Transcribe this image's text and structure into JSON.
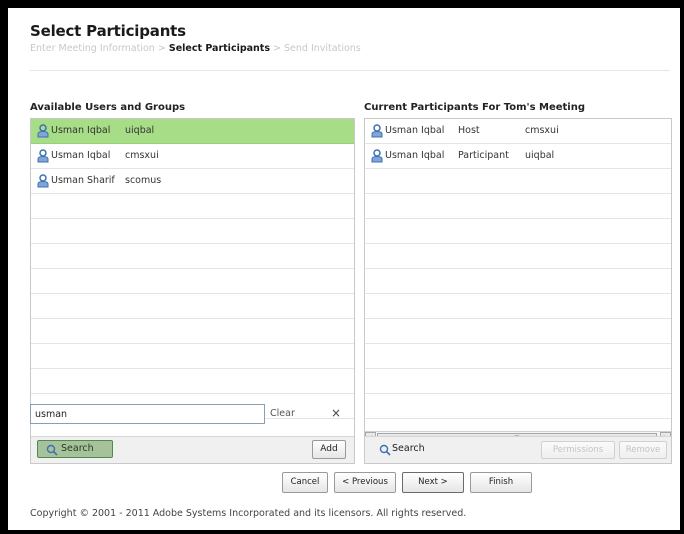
{
  "page": {
    "title": "Select Participants",
    "breadcrumb": {
      "step1": "Enter Meeting Information",
      "sep": ">",
      "step2": "Select Participants",
      "step3": "Send Invitations"
    }
  },
  "available": {
    "title": "Available Users and Groups",
    "rows": [
      {
        "name": "Usman Iqbal",
        "login": "uiqbal"
      },
      {
        "name": "Usman Iqbal",
        "login": "cmsxui"
      },
      {
        "name": "Usman Sharif",
        "login": "scomus"
      }
    ],
    "search_value": "usman",
    "clear_label": "Clear",
    "clear_icon": "×",
    "search_label": "Search",
    "add_label": "Add"
  },
  "current": {
    "title": "Current Participants For Tom's Meeting",
    "rows": [
      {
        "name": "Usman Iqbal",
        "role": "Host",
        "login": "cmsxui"
      },
      {
        "name": "Usman Iqbal",
        "role": "Participant",
        "login": "uiqbal"
      }
    ],
    "search_label": "Search",
    "permissions_label": "Permissions",
    "remove_label": "Remove",
    "scroll_left": "◂",
    "scroll_right": "▸",
    "scroll_grip": "≡"
  },
  "wizard": {
    "cancel": "Cancel",
    "previous": "< Previous",
    "next": "Next >",
    "finish": "Finish"
  },
  "copyright": "Copyright © 2001 - 2011 Adobe Systems Incorporated and its licensors. All rights reserved.",
  "colors": {
    "selected_row": "#a6dd86",
    "user_icon": "#3d6fb5"
  }
}
